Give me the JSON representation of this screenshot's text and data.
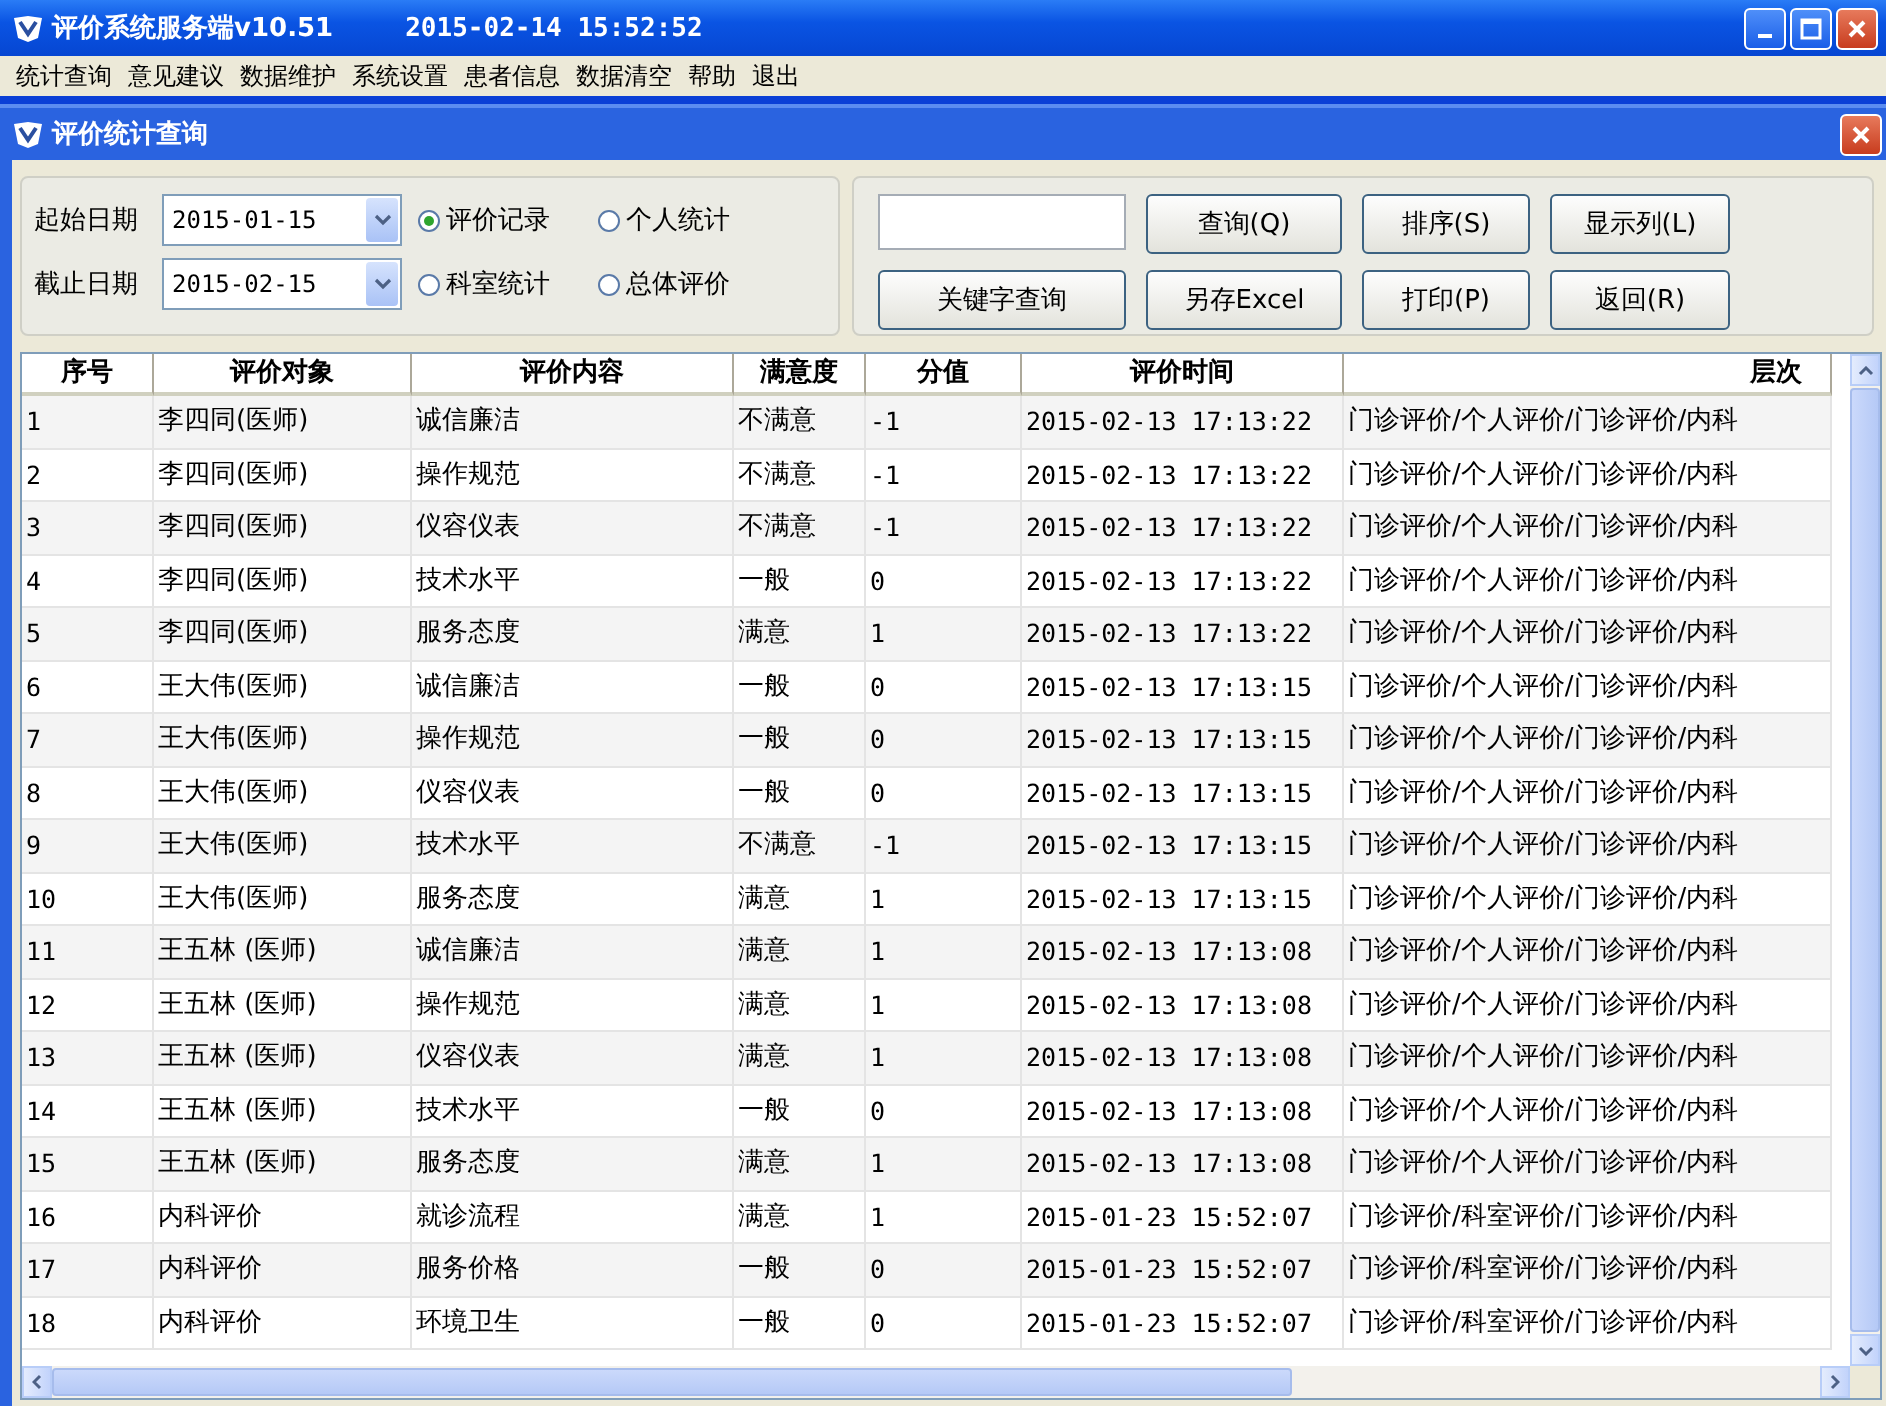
{
  "window": {
    "title": "评价系统服务端v10.51",
    "datetime": "2015-02-14 15:52:52"
  },
  "menu": [
    "统计查询",
    "意见建议",
    "数据维护",
    "系统设置",
    "患者信息",
    "数据清空",
    "帮助",
    "退出"
  ],
  "child_window": {
    "title": "评价统计查询"
  },
  "filters": {
    "start_label": "起始日期",
    "start_date": "2015-01-15",
    "end_label": "截止日期",
    "end_date": "2015-02-15",
    "modes": [
      {
        "label": "评价记录",
        "selected": true
      },
      {
        "label": "个人统计",
        "selected": false
      },
      {
        "label": "科室统计",
        "selected": false
      },
      {
        "label": "总体评价",
        "selected": false
      }
    ]
  },
  "actions": {
    "buttons": [
      {
        "label": "查询(Q)"
      },
      {
        "label": "排序(S)"
      },
      {
        "label": "显示列(L)"
      },
      {
        "label": "关键字查询"
      },
      {
        "label": "另存Excel"
      },
      {
        "label": "打印(P)"
      },
      {
        "label": "返回(R)"
      }
    ]
  },
  "table": {
    "columns": [
      "序号",
      "评价对象",
      "评价内容",
      "满意度",
      "分值",
      "评价时间",
      "层次"
    ],
    "rows": [
      [
        "1",
        "李四同(医师)",
        "诚信廉洁",
        "不满意",
        "-1",
        "2015-02-13 17:13:22",
        "门诊评价/个人评价/门诊评价/内科"
      ],
      [
        "2",
        "李四同(医师)",
        "操作规范",
        "不满意",
        "-1",
        "2015-02-13 17:13:22",
        "门诊评价/个人评价/门诊评价/内科"
      ],
      [
        "3",
        "李四同(医师)",
        "仪容仪表",
        "不满意",
        "-1",
        "2015-02-13 17:13:22",
        "门诊评价/个人评价/门诊评价/内科"
      ],
      [
        "4",
        "李四同(医师)",
        "技术水平",
        "一般",
        "0",
        "2015-02-13 17:13:22",
        "门诊评价/个人评价/门诊评价/内科"
      ],
      [
        "5",
        "李四同(医师)",
        "服务态度",
        "满意",
        "1",
        "2015-02-13 17:13:22",
        "门诊评价/个人评价/门诊评价/内科"
      ],
      [
        "6",
        "王大伟(医师)",
        "诚信廉洁",
        "一般",
        "0",
        "2015-02-13 17:13:15",
        "门诊评价/个人评价/门诊评价/内科"
      ],
      [
        "7",
        "王大伟(医师)",
        "操作规范",
        "一般",
        "0",
        "2015-02-13 17:13:15",
        "门诊评价/个人评价/门诊评价/内科"
      ],
      [
        "8",
        "王大伟(医师)",
        "仪容仪表",
        "一般",
        "0",
        "2015-02-13 17:13:15",
        "门诊评价/个人评价/门诊评价/内科"
      ],
      [
        "9",
        "王大伟(医师)",
        "技术水平",
        "不满意",
        "-1",
        "2015-02-13 17:13:15",
        "门诊评价/个人评价/门诊评价/内科"
      ],
      [
        "10",
        "王大伟(医师)",
        "服务态度",
        "满意",
        "1",
        "2015-02-13 17:13:15",
        "门诊评价/个人评价/门诊评价/内科"
      ],
      [
        "11",
        "王五林 (医师)",
        "诚信廉洁",
        "满意",
        "1",
        "2015-02-13 17:13:08",
        "门诊评价/个人评价/门诊评价/内科"
      ],
      [
        "12",
        "王五林 (医师)",
        "操作规范",
        "满意",
        "1",
        "2015-02-13 17:13:08",
        "门诊评价/个人评价/门诊评价/内科"
      ],
      [
        "13",
        "王五林 (医师)",
        "仪容仪表",
        "满意",
        "1",
        "2015-02-13 17:13:08",
        "门诊评价/个人评价/门诊评价/内科"
      ],
      [
        "14",
        "王五林 (医师)",
        "技术水平",
        "一般",
        "0",
        "2015-02-13 17:13:08",
        "门诊评价/个人评价/门诊评价/内科"
      ],
      [
        "15",
        "王五林 (医师)",
        "服务态度",
        "满意",
        "1",
        "2015-02-13 17:13:08",
        "门诊评价/个人评价/门诊评价/内科"
      ],
      [
        "16",
        "内科评价",
        "就诊流程",
        "满意",
        "1",
        "2015-01-23 15:52:07",
        "门诊评价/科室评价/门诊评价/内科"
      ],
      [
        "17",
        "内科评价",
        "服务价格",
        "一般",
        "0",
        "2015-01-23 15:52:07",
        "门诊评价/科室评价/门诊评价/内科"
      ],
      [
        "18",
        "内科评价",
        "环境卫生",
        "一般",
        "0",
        "2015-01-23 15:52:07",
        "门诊评价/科室评价/门诊评价/内科"
      ]
    ]
  }
}
